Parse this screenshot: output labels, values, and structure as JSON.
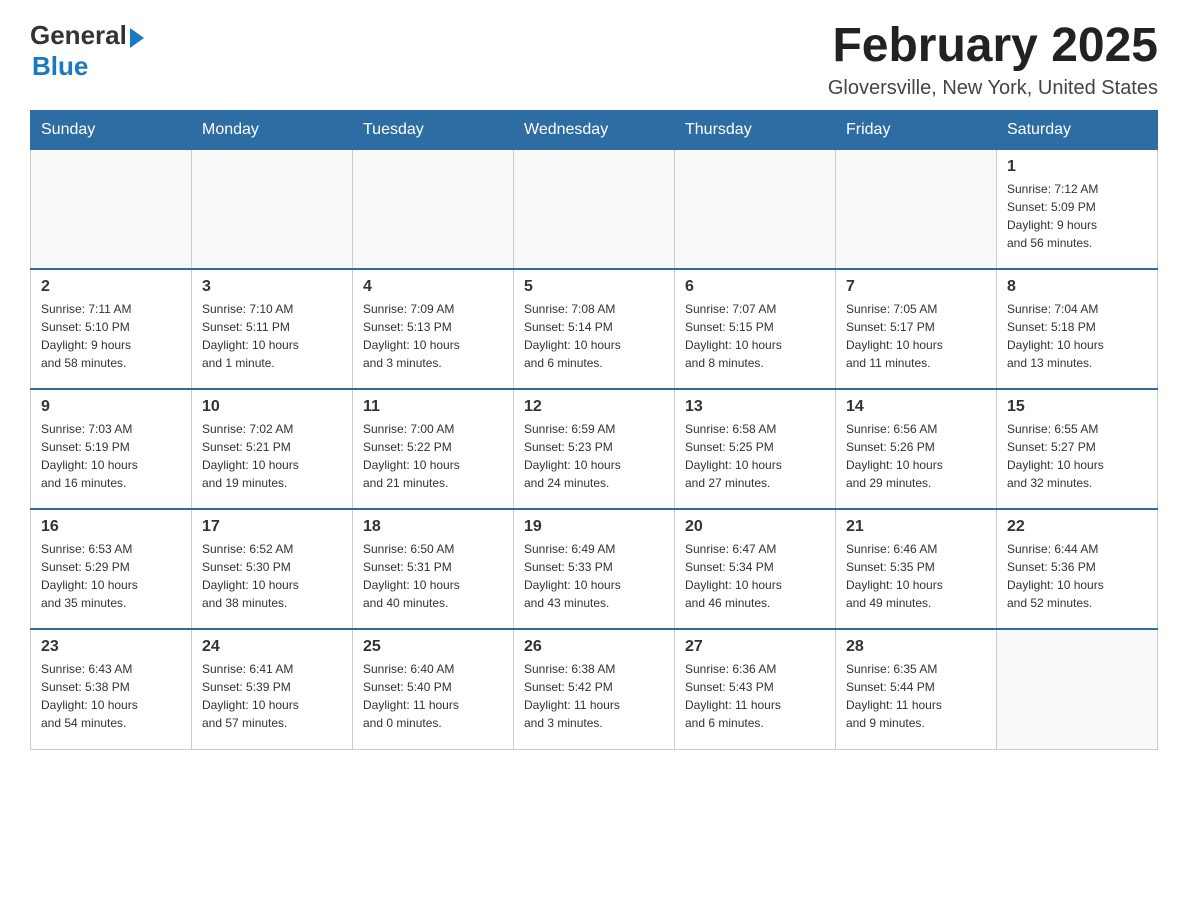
{
  "logo": {
    "general": "General",
    "blue": "Blue"
  },
  "title": "February 2025",
  "location": "Gloversville, New York, United States",
  "days_of_week": [
    "Sunday",
    "Monday",
    "Tuesday",
    "Wednesday",
    "Thursday",
    "Friday",
    "Saturday"
  ],
  "weeks": [
    [
      {
        "day": "",
        "info": ""
      },
      {
        "day": "",
        "info": ""
      },
      {
        "day": "",
        "info": ""
      },
      {
        "day": "",
        "info": ""
      },
      {
        "day": "",
        "info": ""
      },
      {
        "day": "",
        "info": ""
      },
      {
        "day": "1",
        "info": "Sunrise: 7:12 AM\nSunset: 5:09 PM\nDaylight: 9 hours\nand 56 minutes."
      }
    ],
    [
      {
        "day": "2",
        "info": "Sunrise: 7:11 AM\nSunset: 5:10 PM\nDaylight: 9 hours\nand 58 minutes."
      },
      {
        "day": "3",
        "info": "Sunrise: 7:10 AM\nSunset: 5:11 PM\nDaylight: 10 hours\nand 1 minute."
      },
      {
        "day": "4",
        "info": "Sunrise: 7:09 AM\nSunset: 5:13 PM\nDaylight: 10 hours\nand 3 minutes."
      },
      {
        "day": "5",
        "info": "Sunrise: 7:08 AM\nSunset: 5:14 PM\nDaylight: 10 hours\nand 6 minutes."
      },
      {
        "day": "6",
        "info": "Sunrise: 7:07 AM\nSunset: 5:15 PM\nDaylight: 10 hours\nand 8 minutes."
      },
      {
        "day": "7",
        "info": "Sunrise: 7:05 AM\nSunset: 5:17 PM\nDaylight: 10 hours\nand 11 minutes."
      },
      {
        "day": "8",
        "info": "Sunrise: 7:04 AM\nSunset: 5:18 PM\nDaylight: 10 hours\nand 13 minutes."
      }
    ],
    [
      {
        "day": "9",
        "info": "Sunrise: 7:03 AM\nSunset: 5:19 PM\nDaylight: 10 hours\nand 16 minutes."
      },
      {
        "day": "10",
        "info": "Sunrise: 7:02 AM\nSunset: 5:21 PM\nDaylight: 10 hours\nand 19 minutes."
      },
      {
        "day": "11",
        "info": "Sunrise: 7:00 AM\nSunset: 5:22 PM\nDaylight: 10 hours\nand 21 minutes."
      },
      {
        "day": "12",
        "info": "Sunrise: 6:59 AM\nSunset: 5:23 PM\nDaylight: 10 hours\nand 24 minutes."
      },
      {
        "day": "13",
        "info": "Sunrise: 6:58 AM\nSunset: 5:25 PM\nDaylight: 10 hours\nand 27 minutes."
      },
      {
        "day": "14",
        "info": "Sunrise: 6:56 AM\nSunset: 5:26 PM\nDaylight: 10 hours\nand 29 minutes."
      },
      {
        "day": "15",
        "info": "Sunrise: 6:55 AM\nSunset: 5:27 PM\nDaylight: 10 hours\nand 32 minutes."
      }
    ],
    [
      {
        "day": "16",
        "info": "Sunrise: 6:53 AM\nSunset: 5:29 PM\nDaylight: 10 hours\nand 35 minutes."
      },
      {
        "day": "17",
        "info": "Sunrise: 6:52 AM\nSunset: 5:30 PM\nDaylight: 10 hours\nand 38 minutes."
      },
      {
        "day": "18",
        "info": "Sunrise: 6:50 AM\nSunset: 5:31 PM\nDaylight: 10 hours\nand 40 minutes."
      },
      {
        "day": "19",
        "info": "Sunrise: 6:49 AM\nSunset: 5:33 PM\nDaylight: 10 hours\nand 43 minutes."
      },
      {
        "day": "20",
        "info": "Sunrise: 6:47 AM\nSunset: 5:34 PM\nDaylight: 10 hours\nand 46 minutes."
      },
      {
        "day": "21",
        "info": "Sunrise: 6:46 AM\nSunset: 5:35 PM\nDaylight: 10 hours\nand 49 minutes."
      },
      {
        "day": "22",
        "info": "Sunrise: 6:44 AM\nSunset: 5:36 PM\nDaylight: 10 hours\nand 52 minutes."
      }
    ],
    [
      {
        "day": "23",
        "info": "Sunrise: 6:43 AM\nSunset: 5:38 PM\nDaylight: 10 hours\nand 54 minutes."
      },
      {
        "day": "24",
        "info": "Sunrise: 6:41 AM\nSunset: 5:39 PM\nDaylight: 10 hours\nand 57 minutes."
      },
      {
        "day": "25",
        "info": "Sunrise: 6:40 AM\nSunset: 5:40 PM\nDaylight: 11 hours\nand 0 minutes."
      },
      {
        "day": "26",
        "info": "Sunrise: 6:38 AM\nSunset: 5:42 PM\nDaylight: 11 hours\nand 3 minutes."
      },
      {
        "day": "27",
        "info": "Sunrise: 6:36 AM\nSunset: 5:43 PM\nDaylight: 11 hours\nand 6 minutes."
      },
      {
        "day": "28",
        "info": "Sunrise: 6:35 AM\nSunset: 5:44 PM\nDaylight: 11 hours\nand 9 minutes."
      },
      {
        "day": "",
        "info": ""
      }
    ]
  ]
}
